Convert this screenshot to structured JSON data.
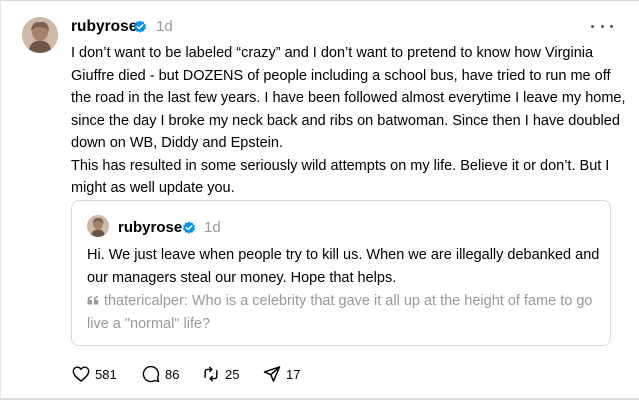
{
  "post": {
    "author": "rubyrose",
    "timestamp": "1d",
    "verified": true,
    "paragraphs": [
      "I don’t want to be labeled “crazy” and I don’t want to pretend to know how Virginia Giuffre died - but DOZENS of people including a school bus, have tried to run me off the road in the last few years. I have been followed almost everytime I leave my home, since the day I broke my neck back and ribs on batwoman. Since then I have doubled down on WB, Diddy and Epstein.",
      "This has resulted in some seriously wild attempts on my life. Believe it or don’t. But I might as well update you."
    ]
  },
  "quote": {
    "author": "rubyrose",
    "timestamp": "1d",
    "verified": true,
    "text": "Hi. We just leave when people try to kill us. When we are illegally debanked and our managers steal our money. Hope that helps.",
    "referenced": {
      "handle": "thatericalper",
      "text": "Who is a celebrity that gave it all up at the height of fame to go live a \"normal\" life?"
    }
  },
  "actions": {
    "likes": "581",
    "replies": "86",
    "reposts": "25",
    "shares": "17"
  },
  "icons": {
    "more": "more-horizontal-icon",
    "like": "heart-icon",
    "reply": "comment-icon",
    "repost": "repost-icon",
    "share": "share-icon",
    "quote": "quote-mark-icon",
    "verified": "verified-badge-icon"
  },
  "colors": {
    "verified": "#0095f6",
    "muted": "#999999",
    "text": "#000000",
    "border": "#d9d9d9"
  }
}
